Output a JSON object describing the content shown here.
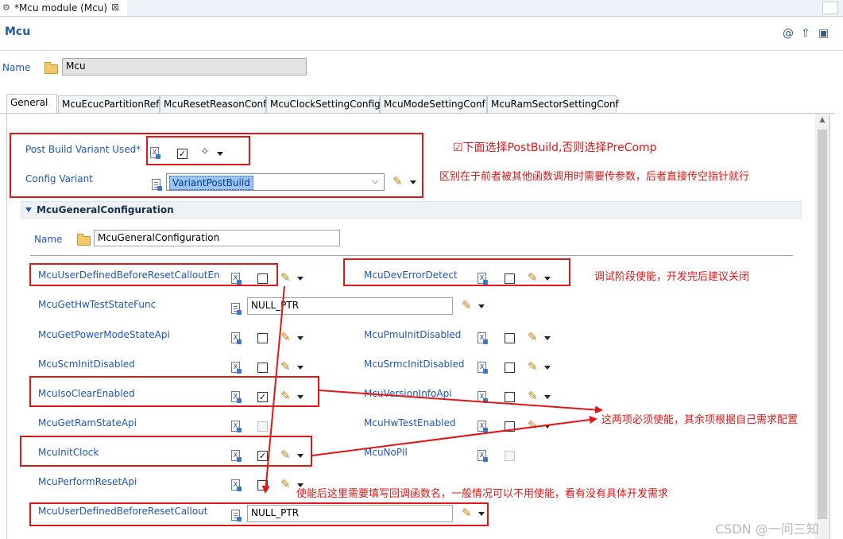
{
  "editor_tab": {
    "title": "*Mcu module (Mcu)",
    "close": "⊠"
  },
  "header": {
    "title": "Mcu"
  },
  "name_field": {
    "label": "Name",
    "value": "Mcu"
  },
  "module_tabs": [
    "General",
    "McuEcucPartitionRef",
    "McuResetReasonConf",
    "McuClockSettingConfig",
    "McuModeSettingConf",
    "McuRamSectorSettingConf"
  ],
  "general": {
    "post_build_label": "Post Build Variant Used*",
    "post_build_checked": true,
    "config_variant_label": "Config Variant",
    "config_variant_value": "VariantPostBuild"
  },
  "section": {
    "title": "McuGeneralConfiguration",
    "name_label": "Name",
    "name_value": "McuGeneralConfiguration"
  },
  "params": {
    "user_defined_before_reset_en": {
      "label": "McuUserDefinedBeforeResetCalloutEn",
      "checked": false
    },
    "dev_error_detect": {
      "label": "McuDevErrorDetect",
      "checked": false
    },
    "hw_test_state_func": {
      "label": "McuGetHwTestStateFunc",
      "value": "NULL_PTR"
    },
    "power_mode_state_api": {
      "label": "McuGetPowerModeStateApi",
      "checked": false
    },
    "pmu_init_disabled": {
      "label": "McuPmuInitDisabled",
      "checked": false
    },
    "scm_init_disabled": {
      "label": "McuScmInitDisabled",
      "checked": false
    },
    "srmc_init_disabled": {
      "label": "McuSrmcInitDisabled",
      "checked": false
    },
    "iso_clear_enabled": {
      "label": "McuIsoClearEnabled",
      "checked": true
    },
    "version_info_api": {
      "label": "McuVersionInfoApi",
      "checked": false
    },
    "ram_state_api": {
      "label": "McuGetRamStateApi",
      "checked": false
    },
    "hw_test_enabled": {
      "label": "McuHwTestEnabled",
      "checked": false
    },
    "init_clock": {
      "label": "McuInitClock",
      "checked": true
    },
    "no_pll": {
      "label": "McuNoPll",
      "checked": false
    },
    "perform_reset_api": {
      "label": "McuPerformResetApi",
      "checked": false
    },
    "user_defined_before_reset": {
      "label": "McuUserDefinedBeforeResetCallout",
      "value": "NULL_PTR"
    }
  },
  "annotations": {
    "postbuild_note": "☑下面选择PostBuild,否则选择PreComp",
    "difference_note": "区别在于前者被其他函数调用时需要传参数，后者直接传空指针就行",
    "debug_note": "调试阶段使能，开发完后建议关闭",
    "must_enable_note": "这两项必须使能，其余项根据自己需求配置",
    "callback_note": "使能后这里需要填写回调函数名，一般情况可以不用使能，看有没有具体开发需求"
  },
  "watermark": "CSDN @一问三知",
  "colors": {
    "label_blue": "#1f57b0",
    "annotation_red": "#e11616",
    "selection_blue": "#99c4f5"
  }
}
